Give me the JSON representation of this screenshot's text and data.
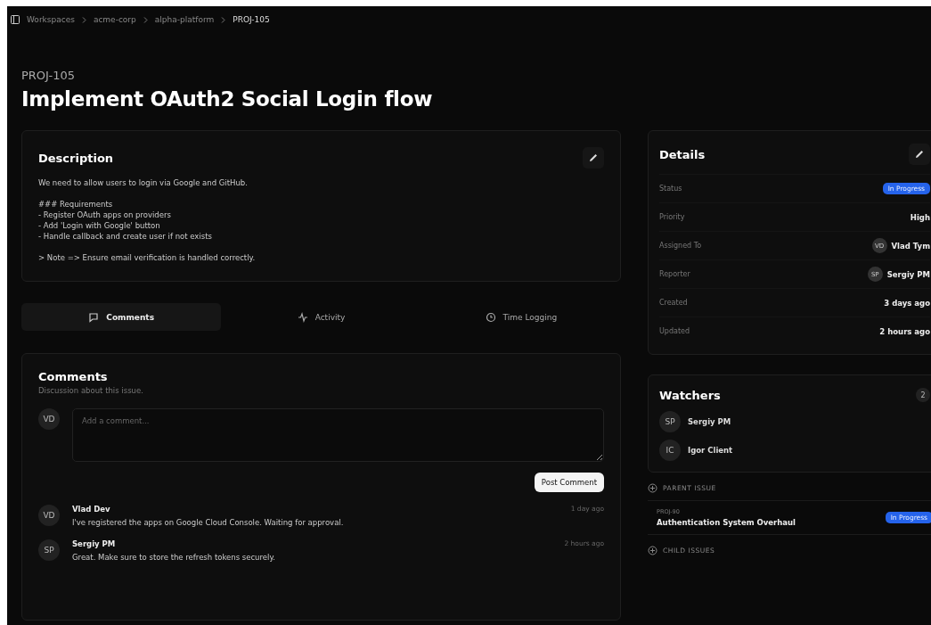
{
  "breadcrumb": [
    "Workspaces",
    "acme-corp",
    "alpha-platform",
    "PROJ-105"
  ],
  "issue": {
    "key": "PROJ-105",
    "title": "Implement OAuth2 Social Login flow"
  },
  "description": {
    "title": "Description",
    "paragraphs": [
      [
        "We need to allow users to login via Google and GitHub."
      ],
      [
        "### Requirements",
        "- Register OAuth apps on providers",
        "- Add 'Login with Google' button",
        "- Handle callback and create user if not exists"
      ],
      [
        "> Note => Ensure email verification is handled correctly."
      ]
    ]
  },
  "tabs": [
    {
      "label": "Comments",
      "selected": true
    },
    {
      "label": "Activity",
      "selected": false
    },
    {
      "label": "Time Logging",
      "selected": false
    }
  ],
  "comments": {
    "title": "Comments",
    "subtitle": "Discussion about this issue.",
    "avatar": "VD",
    "placeholder": "Add a comment...",
    "button": "Post Comment",
    "items": [
      {
        "avatar": "VD",
        "author": "Vlad Dev",
        "time": "1 day ago",
        "text": "I've registered the apps on Google Cloud Console. Waiting for approval."
      },
      {
        "avatar": "SP",
        "author": "Sergiy PM",
        "time": "2 hours ago",
        "text": "Great. Make sure to store the refresh tokens securely."
      }
    ]
  },
  "details": {
    "title": "Details",
    "rows": [
      {
        "label": "Status",
        "kind": "badge",
        "value": "In Progress"
      },
      {
        "label": "Priority",
        "kind": "text",
        "value": "High"
      },
      {
        "label": "Assigned To",
        "kind": "user",
        "avatar": "VD",
        "value": "Vlad Tym"
      },
      {
        "label": "Reporter",
        "kind": "user",
        "avatar": "SP",
        "value": "Sergiy PM"
      },
      {
        "label": "Created",
        "kind": "text",
        "value": "3 days ago"
      },
      {
        "label": "Updated",
        "kind": "text",
        "value": "2 hours ago"
      }
    ]
  },
  "watchers": {
    "title": "Watchers",
    "count": "2",
    "items": [
      {
        "avatar": "SP",
        "name": "Sergiy PM"
      },
      {
        "avatar": "IC",
        "name": "Igor Client"
      }
    ]
  },
  "parent_issue": {
    "label": "PARENT ISSUE",
    "key": "PROJ-90",
    "title": "Authentication System Overhaul",
    "status": "In Progress"
  },
  "child_issues": {
    "label": "CHILD ISSUES"
  }
}
